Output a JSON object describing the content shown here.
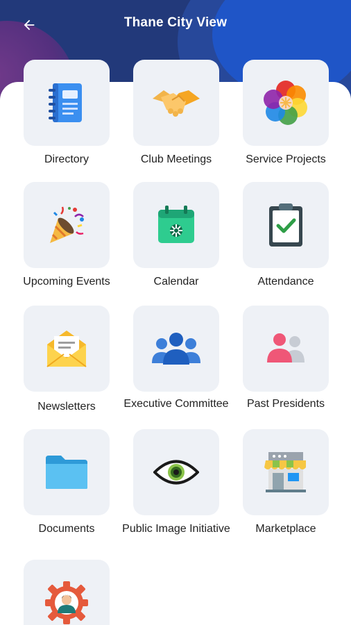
{
  "header": {
    "title": "Thane City View",
    "back_icon": "arrow-left-icon"
  },
  "menu": {
    "items": [
      {
        "label": "Directory",
        "icon": "notebook-icon"
      },
      {
        "label": "Club Meetings",
        "icon": "handshake-icon"
      },
      {
        "label": "Service Projects",
        "icon": "rainbow-flower-icon"
      },
      {
        "label": "Upcoming Events",
        "icon": "party-popper-icon"
      },
      {
        "label": "Calendar",
        "icon": "calendar-icon"
      },
      {
        "label": "Attendance",
        "icon": "clipboard-check-icon"
      },
      {
        "label": "Newsletters",
        "icon": "open-envelope-icon"
      },
      {
        "label": "Executive Committee",
        "icon": "group-icon"
      },
      {
        "label": "Past Presidents",
        "icon": "people-icon"
      },
      {
        "label": "Documents",
        "icon": "folder-icon"
      },
      {
        "label": "Public Image Initiative",
        "icon": "eye-icon"
      },
      {
        "label": "Marketplace",
        "icon": "shop-icon"
      },
      {
        "label": "",
        "icon": "gear-person-icon"
      }
    ]
  },
  "colors": {
    "header_bg": "#22397a",
    "tile_bg": "#eef1f6"
  }
}
